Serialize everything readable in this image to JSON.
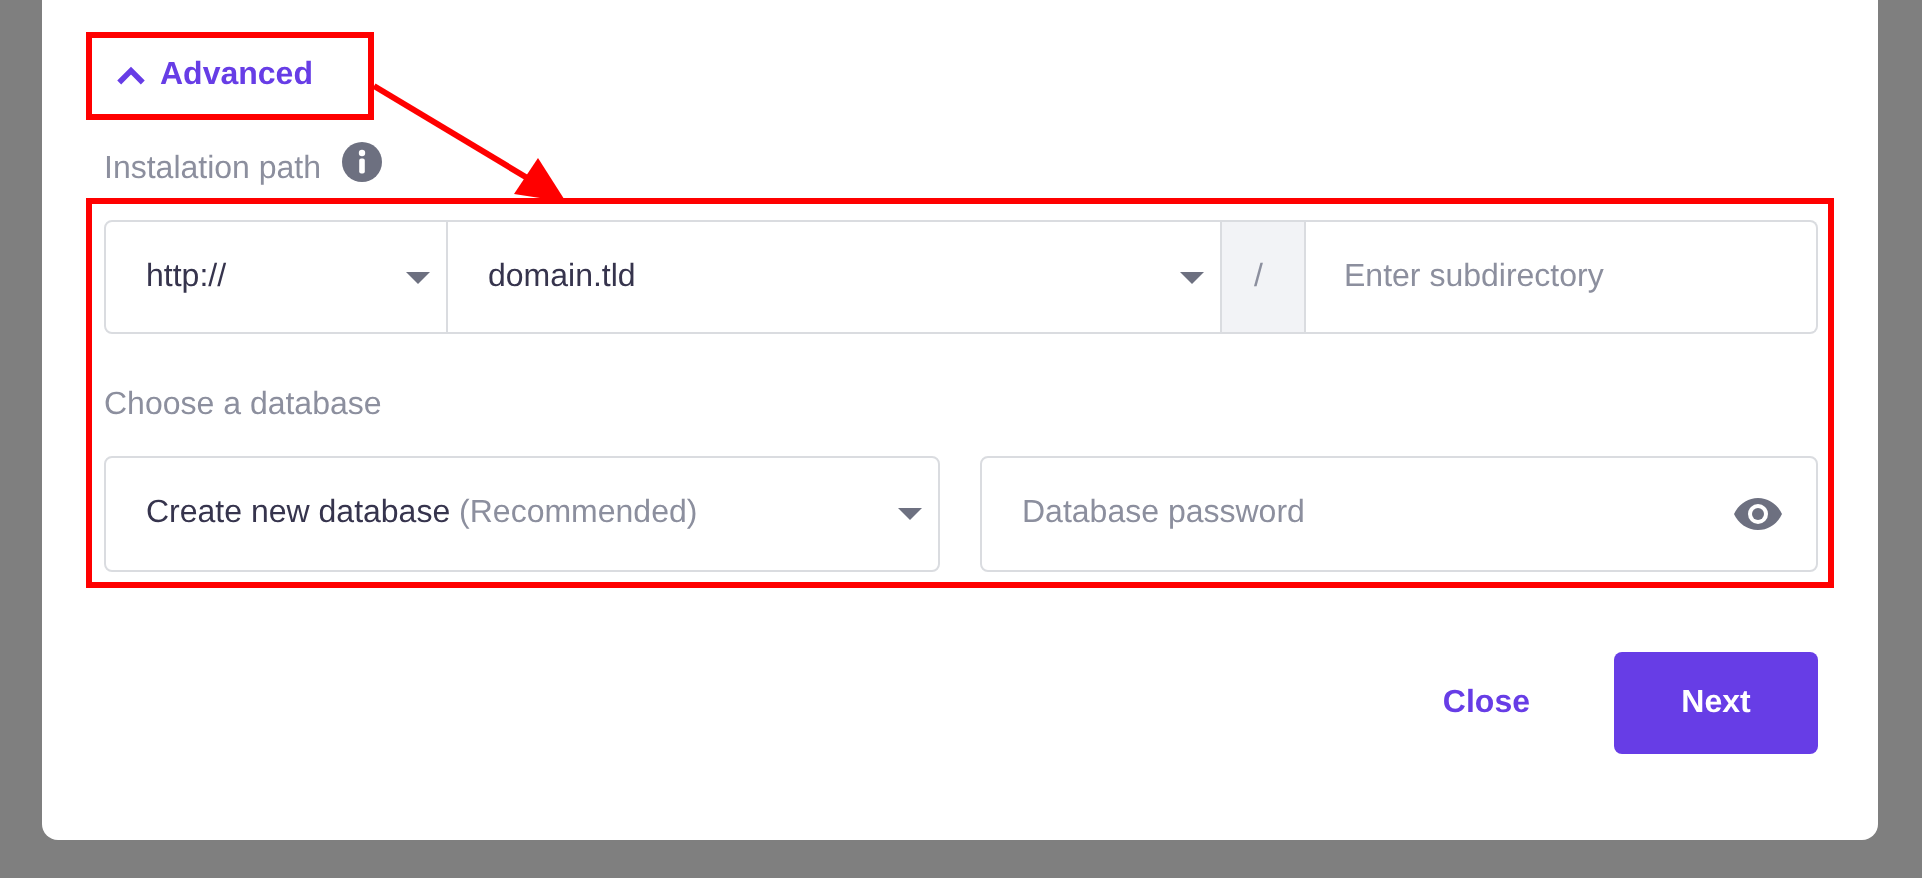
{
  "advanced_toggle": {
    "label": "Advanced",
    "expanded": true
  },
  "installation_path": {
    "label": "Instalation path",
    "protocol": {
      "value": "http://"
    },
    "domain": {
      "value": "domain.tld"
    },
    "separator": "/",
    "subdirectory": {
      "placeholder": "Enter subdirectory"
    }
  },
  "database": {
    "label": "Choose a database",
    "select": {
      "value": "Create new database",
      "note": "(Recommended)"
    },
    "password": {
      "placeholder": "Database password"
    }
  },
  "buttons": [
    {
      "label": "Close",
      "kind": "text"
    },
    {
      "label": "Next",
      "kind": "primary"
    }
  ]
}
